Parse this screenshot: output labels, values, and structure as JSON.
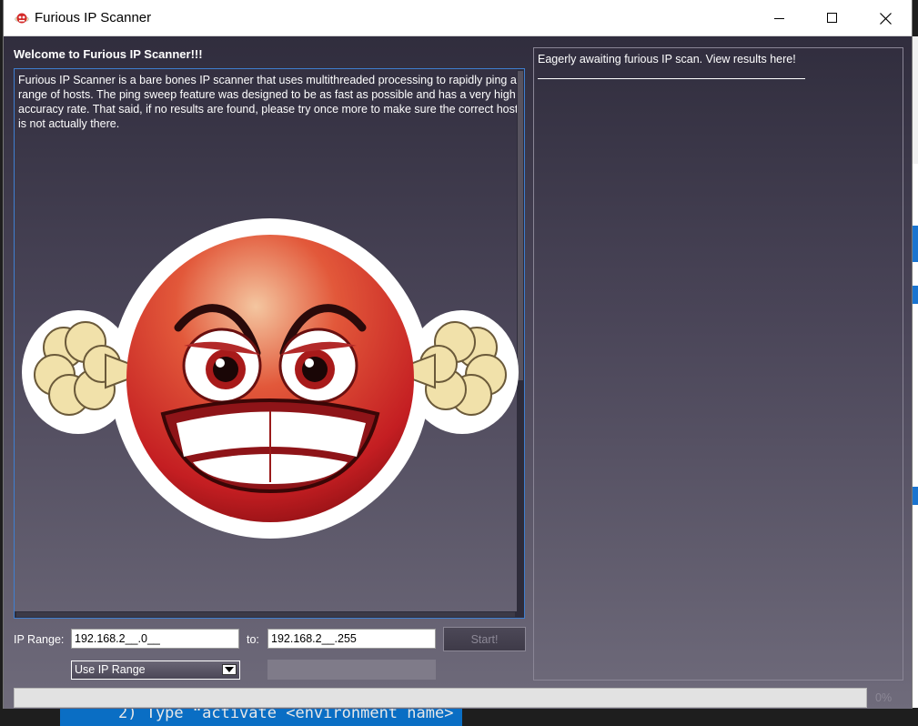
{
  "window": {
    "title": "Furious IP Scanner",
    "icon": "angry-face-icon",
    "controls": [
      "minimize-icon",
      "maximize-icon",
      "close-icon"
    ]
  },
  "welcome": {
    "heading": "Welcome to Furious IP Scanner!!!",
    "description": "Furious IP Scanner is a bare bones IP scanner that uses multithreaded processing to rapidly ping a range of hosts. The ping sweep feature was designed to be as fast as possible and has a very high accuracy rate. That said, if no results are found, please try once more to make sure the correct host is not actually there.",
    "image": "angry-emoji-illustration"
  },
  "results": {
    "status": "Eagerly awaiting furious IP scan. View results here!"
  },
  "controls": {
    "ip_range_label": "IP Range:",
    "ip_from_value": "192.168.2__.0__",
    "to_label": "to:",
    "ip_to_value": "192.168.2__.255",
    "start_label": "Start!",
    "mode_selected": "Use IP Range"
  },
  "progress": {
    "value": 0,
    "label": "0%"
  },
  "background": {
    "terminal_text": "2) Type “activate <environment name>"
  },
  "colors": {
    "accent": "#3f7fd0",
    "text": "#ffffff",
    "disabled": "#8c8896"
  }
}
